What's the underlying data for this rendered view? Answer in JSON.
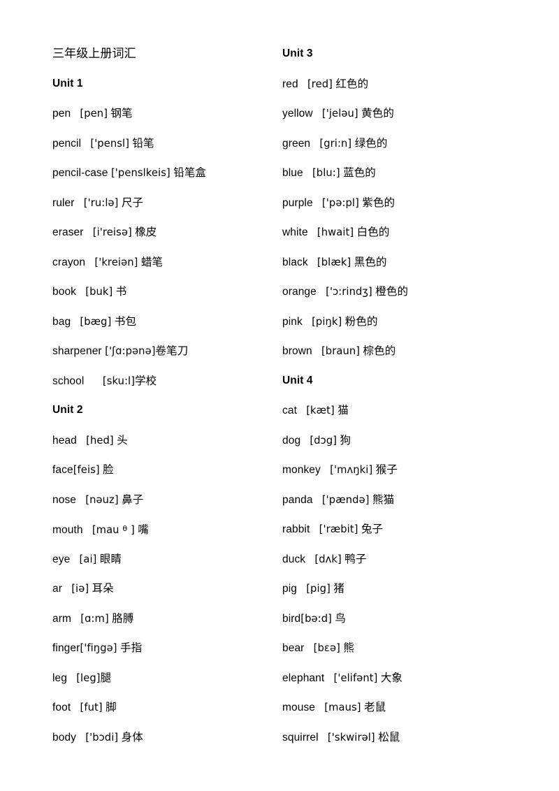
{
  "document": {
    "title": "三年级上册词汇",
    "background_color": "#ffffff",
    "text_color": "#000000"
  },
  "columns": [
    {
      "name": "left-column",
      "blocks": [
        {
          "type": "title",
          "text": "三年级上册词汇"
        },
        {
          "type": "heading",
          "text": "Unit 1"
        },
        {
          "type": "entry",
          "word": "pen",
          "gap1": "   ",
          "phonetic": "[pen]",
          "gap2": " ",
          "chinese": "钢笔"
        },
        {
          "type": "entry",
          "word": "pencil",
          "gap1": "   ",
          "phonetic": "['pensl]",
          "gap2": " ",
          "chinese": "铅笔"
        },
        {
          "type": "entry",
          "word": "pencil-case",
          "gap1": " ",
          "phonetic": "['penslkeis]",
          "gap2": " ",
          "chinese": "铅笔盒"
        },
        {
          "type": "entry",
          "word": "ruler",
          "gap1": "   ",
          "phonetic": "['ru:lə]",
          "gap2": " ",
          "chinese": "尺子"
        },
        {
          "type": "entry",
          "word": "eraser",
          "gap1": "   ",
          "phonetic": "[i'reisə]",
          "gap2": " ",
          "chinese": "橡皮"
        },
        {
          "type": "entry",
          "word": "crayon",
          "gap1": "   ",
          "phonetic": "['kreiən]",
          "gap2": " ",
          "chinese": "蜡笔"
        },
        {
          "type": "entry",
          "word": "book",
          "gap1": "   ",
          "phonetic": "[buk]",
          "gap2": " ",
          "chinese": "书"
        },
        {
          "type": "entry",
          "word": "bag",
          "gap1": "   ",
          "phonetic": "[bæg]",
          "gap2": " ",
          "chinese": "书包"
        },
        {
          "type": "entry",
          "word": "sharpener",
          "gap1": " ",
          "phonetic": "['ʃɑ:pənə]",
          "gap2": "",
          "chinese": "卷笔刀"
        },
        {
          "type": "entry",
          "word": "school",
          "gap1": "      ",
          "phonetic": "[sku:l]",
          "gap2": "",
          "chinese": "学校"
        },
        {
          "type": "heading",
          "text": "Unit 2"
        },
        {
          "type": "entry",
          "word": "head",
          "gap1": "   ",
          "phonetic": "[hed]",
          "gap2": " ",
          "chinese": "头"
        },
        {
          "type": "entry",
          "word": "face",
          "gap1": "",
          "phonetic": "[feis]",
          "gap2": " ",
          "chinese": "脸"
        },
        {
          "type": "entry",
          "word": "nose",
          "gap1": "   ",
          "phonetic": "[nəuz]",
          "gap2": " ",
          "chinese": "鼻子"
        },
        {
          "type": "entry",
          "word": "mouth",
          "gap1": "   ",
          "phonetic": "[mau θ ]",
          "gap2": " ",
          "chinese": "嘴",
          "phonetic_has_superscript_theta": true
        },
        {
          "type": "entry",
          "word": "eye",
          "gap1": "   ",
          "phonetic": "[ai]",
          "gap2": " ",
          "chinese": "眼睛"
        },
        {
          "type": "entry",
          "word": "ar",
          "gap1": "   ",
          "phonetic": "[iə]",
          "gap2": " ",
          "chinese": "耳朵"
        },
        {
          "type": "entry",
          "word": "arm",
          "gap1": "   ",
          "phonetic": "[ɑ:m]",
          "gap2": " ",
          "chinese": "胳膊"
        },
        {
          "type": "entry",
          "word": "finger",
          "gap1": "",
          "phonetic": "['fiŋgə]",
          "gap2": " ",
          "chinese": "手指"
        },
        {
          "type": "entry",
          "word": "leg",
          "gap1": "   ",
          "phonetic": "[leg]",
          "gap2": "",
          "chinese": "腿"
        },
        {
          "type": "entry",
          "word": "foot",
          "gap1": "   ",
          "phonetic": "[fut]",
          "gap2": " ",
          "chinese": "脚"
        },
        {
          "type": "entry",
          "word": "body",
          "gap1": "   ",
          "phonetic": "['bɔdi]",
          "gap2": " ",
          "chinese": "身体"
        }
      ]
    },
    {
      "name": "right-column",
      "blocks": [
        {
          "type": "heading",
          "text": "Unit 3"
        },
        {
          "type": "entry",
          "word": "red",
          "gap1": "   ",
          "phonetic": "[red]",
          "gap2": " ",
          "chinese": "红色的"
        },
        {
          "type": "entry",
          "word": "yellow",
          "gap1": "   ",
          "phonetic": "['jeləu]",
          "gap2": " ",
          "chinese": "黄色的"
        },
        {
          "type": "entry",
          "word": "green",
          "gap1": "   ",
          "phonetic": "[gri:n]",
          "gap2": " ",
          "chinese": "绿色的"
        },
        {
          "type": "entry",
          "word": "blue",
          "gap1": "   ",
          "phonetic": "[blu:]",
          "gap2": " ",
          "chinese": "蓝色的"
        },
        {
          "type": "entry",
          "word": "purple",
          "gap1": "   ",
          "phonetic": "['pə:pl]",
          "gap2": " ",
          "chinese": "紫色的"
        },
        {
          "type": "entry",
          "word": "white",
          "gap1": "   ",
          "phonetic": "[hwait]",
          "gap2": " ",
          "chinese": "白色的"
        },
        {
          "type": "entry",
          "word": "black",
          "gap1": "   ",
          "phonetic": "[blæk]",
          "gap2": " ",
          "chinese": "黑色的"
        },
        {
          "type": "entry",
          "word": "orange",
          "gap1": "   ",
          "phonetic": "['ɔ:rindʒ]",
          "gap2": " ",
          "chinese": "橙色的"
        },
        {
          "type": "entry",
          "word": "pink",
          "gap1": "   ",
          "phonetic": "[piŋk]",
          "gap2": " ",
          "chinese": "粉色的"
        },
        {
          "type": "entry",
          "word": "brown",
          "gap1": "   ",
          "phonetic": "[braun]",
          "gap2": " ",
          "chinese": "棕色的"
        },
        {
          "type": "heading",
          "text": "Unit 4"
        },
        {
          "type": "entry",
          "word": "cat",
          "gap1": "   ",
          "phonetic": "[kæt]",
          "gap2": " ",
          "chinese": "猫"
        },
        {
          "type": "entry",
          "word": "dog",
          "gap1": "   ",
          "phonetic": "[dɔg]",
          "gap2": " ",
          "chinese": "狗"
        },
        {
          "type": "entry",
          "word": "monkey",
          "gap1": "   ",
          "phonetic": "['mʌŋki]",
          "gap2": " ",
          "chinese": "猴子"
        },
        {
          "type": "entry",
          "word": "panda",
          "gap1": "   ",
          "phonetic": "['pændə]",
          "gap2": " ",
          "chinese": "熊猫"
        },
        {
          "type": "entry",
          "word": "rabbit",
          "gap1": "   ",
          "phonetic": "['ræbit]",
          "gap2": " ",
          "chinese": "兔子"
        },
        {
          "type": "entry",
          "word": "duck",
          "gap1": "   ",
          "phonetic": "[dʌk]",
          "gap2": " ",
          "chinese": "鸭子"
        },
        {
          "type": "entry",
          "word": "pig",
          "gap1": "   ",
          "phonetic": "[pig]",
          "gap2": " ",
          "chinese": "猪"
        },
        {
          "type": "entry",
          "word": "bird",
          "gap1": "",
          "phonetic": "[bə:d]",
          "gap2": " ",
          "chinese": "鸟"
        },
        {
          "type": "entry",
          "word": "bear",
          "gap1": "   ",
          "phonetic": "[bɛə]",
          "gap2": " ",
          "chinese": "熊"
        },
        {
          "type": "entry",
          "word": "elephant",
          "gap1": "   ",
          "phonetic": "['elifənt]",
          "gap2": " ",
          "chinese": "大象"
        },
        {
          "type": "entry",
          "word": "mouse",
          "gap1": "   ",
          "phonetic": "[maus]",
          "gap2": " ",
          "chinese": "老鼠"
        },
        {
          "type": "entry",
          "word": "squirrel",
          "gap1": "   ",
          "phonetic": "['skwirəl]",
          "gap2": " ",
          "chinese": "松鼠"
        }
      ]
    }
  ]
}
